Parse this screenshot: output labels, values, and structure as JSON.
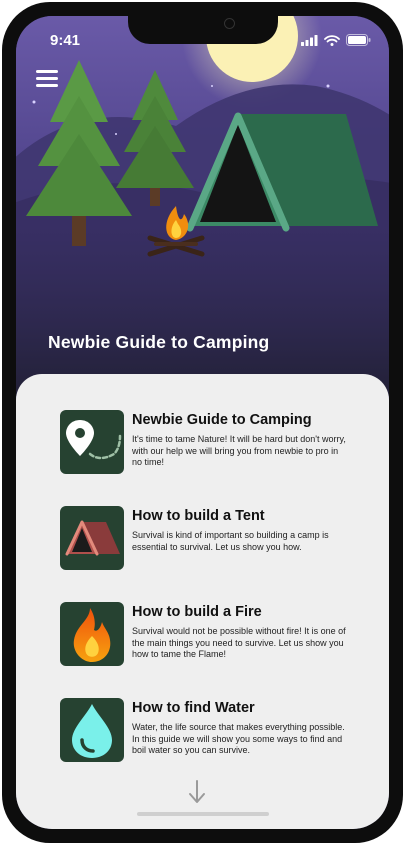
{
  "status": {
    "time": "9:41"
  },
  "hero": {
    "title": "Newbie Guide to Camping"
  },
  "guides": [
    {
      "title": "Newbie Guide to Camping",
      "description": "It's time to tame Nature! It will be hard but don't worry, with our help we will bring you from newbie to pro in no time!"
    },
    {
      "title": "How to build a Tent",
      "description": "Survival is kind of important so building a camp is essential to survival. Let us show you how."
    },
    {
      "title": "How to build a Fire",
      "description": "Survival would not be possible without fire! It is one of the main things you need to survive. Let us show you how to tame the Flame!"
    },
    {
      "title": "How to find Water",
      "description": "Water, the life source that makes everything possible. In this guide we will show you some ways to find and boil water so you can survive."
    }
  ],
  "icons": [
    "menu-icon",
    "signal-icon",
    "wifi-icon",
    "battery-icon",
    "map-pin-icon",
    "tent-icon",
    "fire-icon",
    "water-drop-icon",
    "arrow-down-icon"
  ],
  "colors": {
    "sheet_bg": "#efefef",
    "thumb_bg": "#264231",
    "sky_top": "#5a4f92",
    "tent_green": "#2f6b4d",
    "flame": "#f4a20c",
    "water": "#7af0ea"
  }
}
